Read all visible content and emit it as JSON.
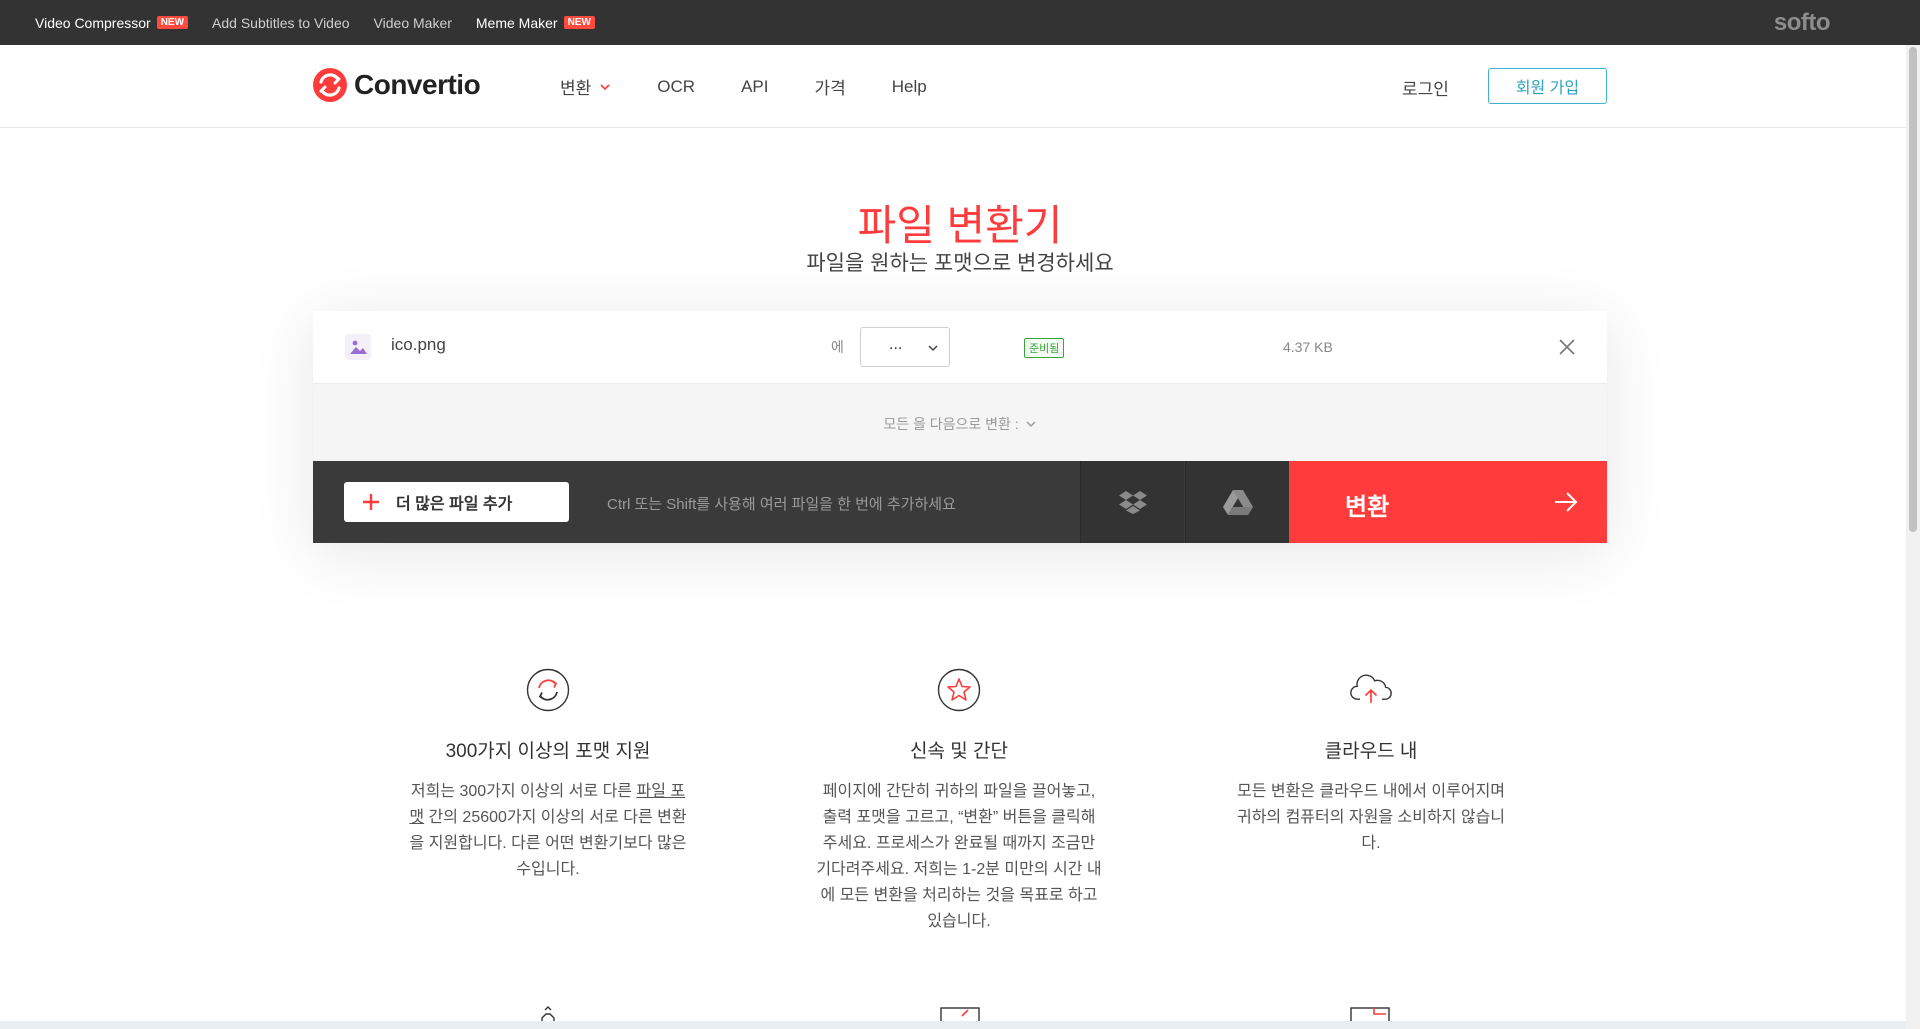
{
  "topbar": {
    "links": [
      {
        "label": "Video Compressor",
        "badge": "NEW"
      },
      {
        "label": "Add Subtitles to Video"
      },
      {
        "label": "Video Maker"
      },
      {
        "label": "Meme Maker",
        "badge": "NEW"
      }
    ],
    "brand": "softo"
  },
  "header": {
    "logo_text": "Convertio",
    "nav": [
      {
        "label": "변환"
      },
      {
        "label": "OCR"
      },
      {
        "label": "API"
      },
      {
        "label": "가격"
      },
      {
        "label": "Help"
      }
    ],
    "login": "로그인",
    "signup": "회원 가입"
  },
  "hero": {
    "title": "파일 변환기",
    "subtitle": "파일을 원하는 포맷으로 변경하세요"
  },
  "converter": {
    "file": {
      "name": "ico.png",
      "to_label": "에",
      "format_value": "...",
      "status": "준비됨",
      "size": "4.37 KB"
    },
    "convert_all_label": "모든 을 다음으로 변환 :",
    "add_more_label": "더 많은 파일 추가",
    "hint": "Ctrl 또는 Shift를 사용해 여러 파일을 한 번에 추가하세요",
    "convert_label": "변환"
  },
  "features": [
    {
      "title": "300가지 이상의 포맷 지원",
      "desc_pre": "저희는 300가지 이상의 서로 다른 ",
      "desc_link": "파일 포맷",
      "desc_post": " 간의 25600가지 이상의 서로 다른 변환을 지원합니다. 다른 어떤 변환기보다 많은 수입니다."
    },
    {
      "title": "신속 및 간단",
      "desc": "페이지에 간단히 귀하의 파일을 끌어놓고, 출력 포맷을 고르고, “변환” 버튼을 클릭해주세요. 프로세스가 완료될 때까지 조금만 기다려주세요. 저희는 1-2분 미만의 시간 내에 모든 변환을 처리하는 것을 목표로 하고 있습니다."
    },
    {
      "title": "클라우드 내",
      "desc": "모든 변환은 클라우드 내에서 이루어지며 귀하의 컴퓨터의 자원을 소비하지 않습니다."
    }
  ],
  "colors": {
    "accent_red": "#ff3b3b",
    "topbar_bg": "#333333",
    "signup_blue": "#2ea2c2",
    "status_green": "#3aa53a",
    "badge_red": "#ff4a3d"
  },
  "icons": {
    "logo": "convertio-logo-icon",
    "file": "image-file-icon",
    "dropbox": "dropbox-icon",
    "gdrive": "google-drive-icon",
    "convert_arrow": "arrow-right-icon",
    "remove": "close-icon"
  }
}
